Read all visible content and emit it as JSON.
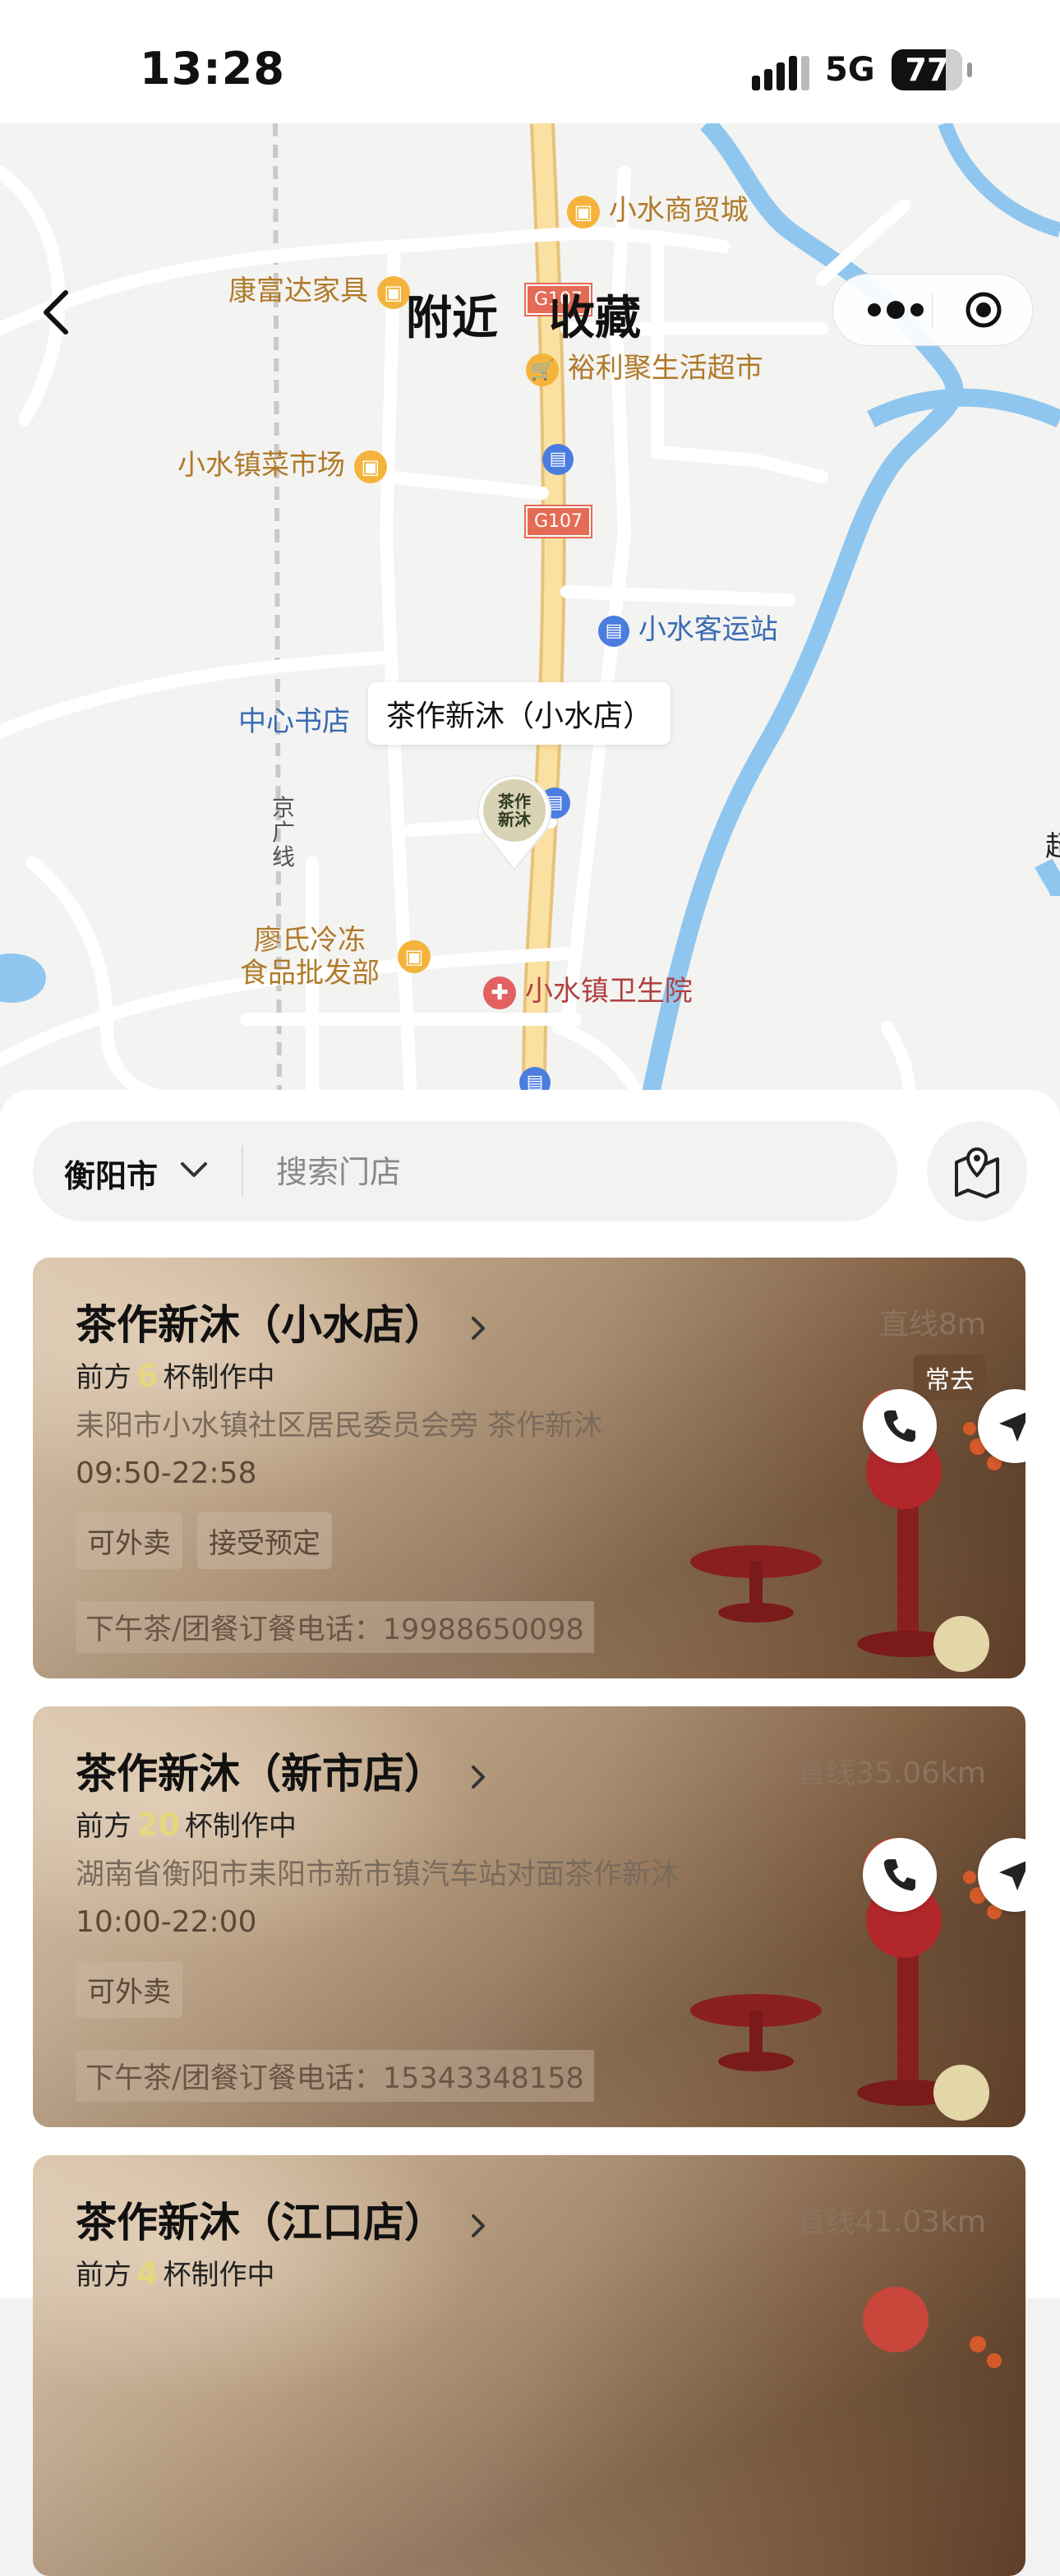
{
  "status_bar": {
    "time": "13:28",
    "network": "5G",
    "battery": "77"
  },
  "map": {
    "pois": [
      {
        "label": "小水商贸城"
      },
      {
        "label": "康富达家具"
      },
      {
        "label": "裕利聚生活超市"
      },
      {
        "label": "小水镇菜市场"
      },
      {
        "label": "小水客运站"
      },
      {
        "label": "中心书店"
      },
      {
        "label": "廖氏冷冻\n食品批发部"
      },
      {
        "label": "小水镇卫生院"
      },
      {
        "label": "京\n广\n线"
      },
      {
        "label": "超"
      }
    ],
    "road_shields": [
      "G107",
      "G107"
    ],
    "store_callout": "茶作新沐（小水店）",
    "marker_text": "茶作\n新沐"
  },
  "nav": {
    "tabs": [
      "附近",
      "收藏"
    ],
    "active_tab": "附近"
  },
  "search": {
    "city": "衡阳市",
    "placeholder": "搜索门店",
    "value": ""
  },
  "stores": [
    {
      "name": "茶作新沐（小水店）",
      "distance": "直线8m",
      "queue_prefix": "前方",
      "queue_count": "6",
      "queue_suffix": "杯制作中",
      "address": "耒阳市小水镇社区居民委员会旁 茶作新沐",
      "hours": "09:50-22:58",
      "tags": [
        "可外卖",
        "接受预定"
      ],
      "phone_line": "下午茶/团餐订餐电话：19988650098",
      "badge": "常去"
    },
    {
      "name": "茶作新沐（新市店）",
      "distance": "直线35.06km",
      "queue_prefix": "前方",
      "queue_count": "20",
      "queue_suffix": "杯制作中",
      "address": "湖南省衡阳市耒阳市新市镇汽车站对面茶作新沐",
      "hours": "10:00-22:00",
      "tags": [
        "可外卖"
      ],
      "phone_line": "下午茶/团餐订餐电话：15343348158",
      "badge": ""
    },
    {
      "name": "茶作新沐（江口店）",
      "distance": "直线41.03km",
      "queue_prefix": "前方",
      "queue_count": "4",
      "queue_suffix": "杯制作中"
    }
  ],
  "colors": {
    "accent_brown": "#8a6a3a",
    "queue_number": "#e6d680",
    "road_highway": "#f6d27a",
    "river": "#8fc6ef"
  },
  "icons": [
    "back-icon",
    "more-icon",
    "target-icon",
    "chevron-down-icon",
    "map-pin-icon",
    "phone-icon",
    "navigate-icon",
    "chevron-right-icon"
  ]
}
